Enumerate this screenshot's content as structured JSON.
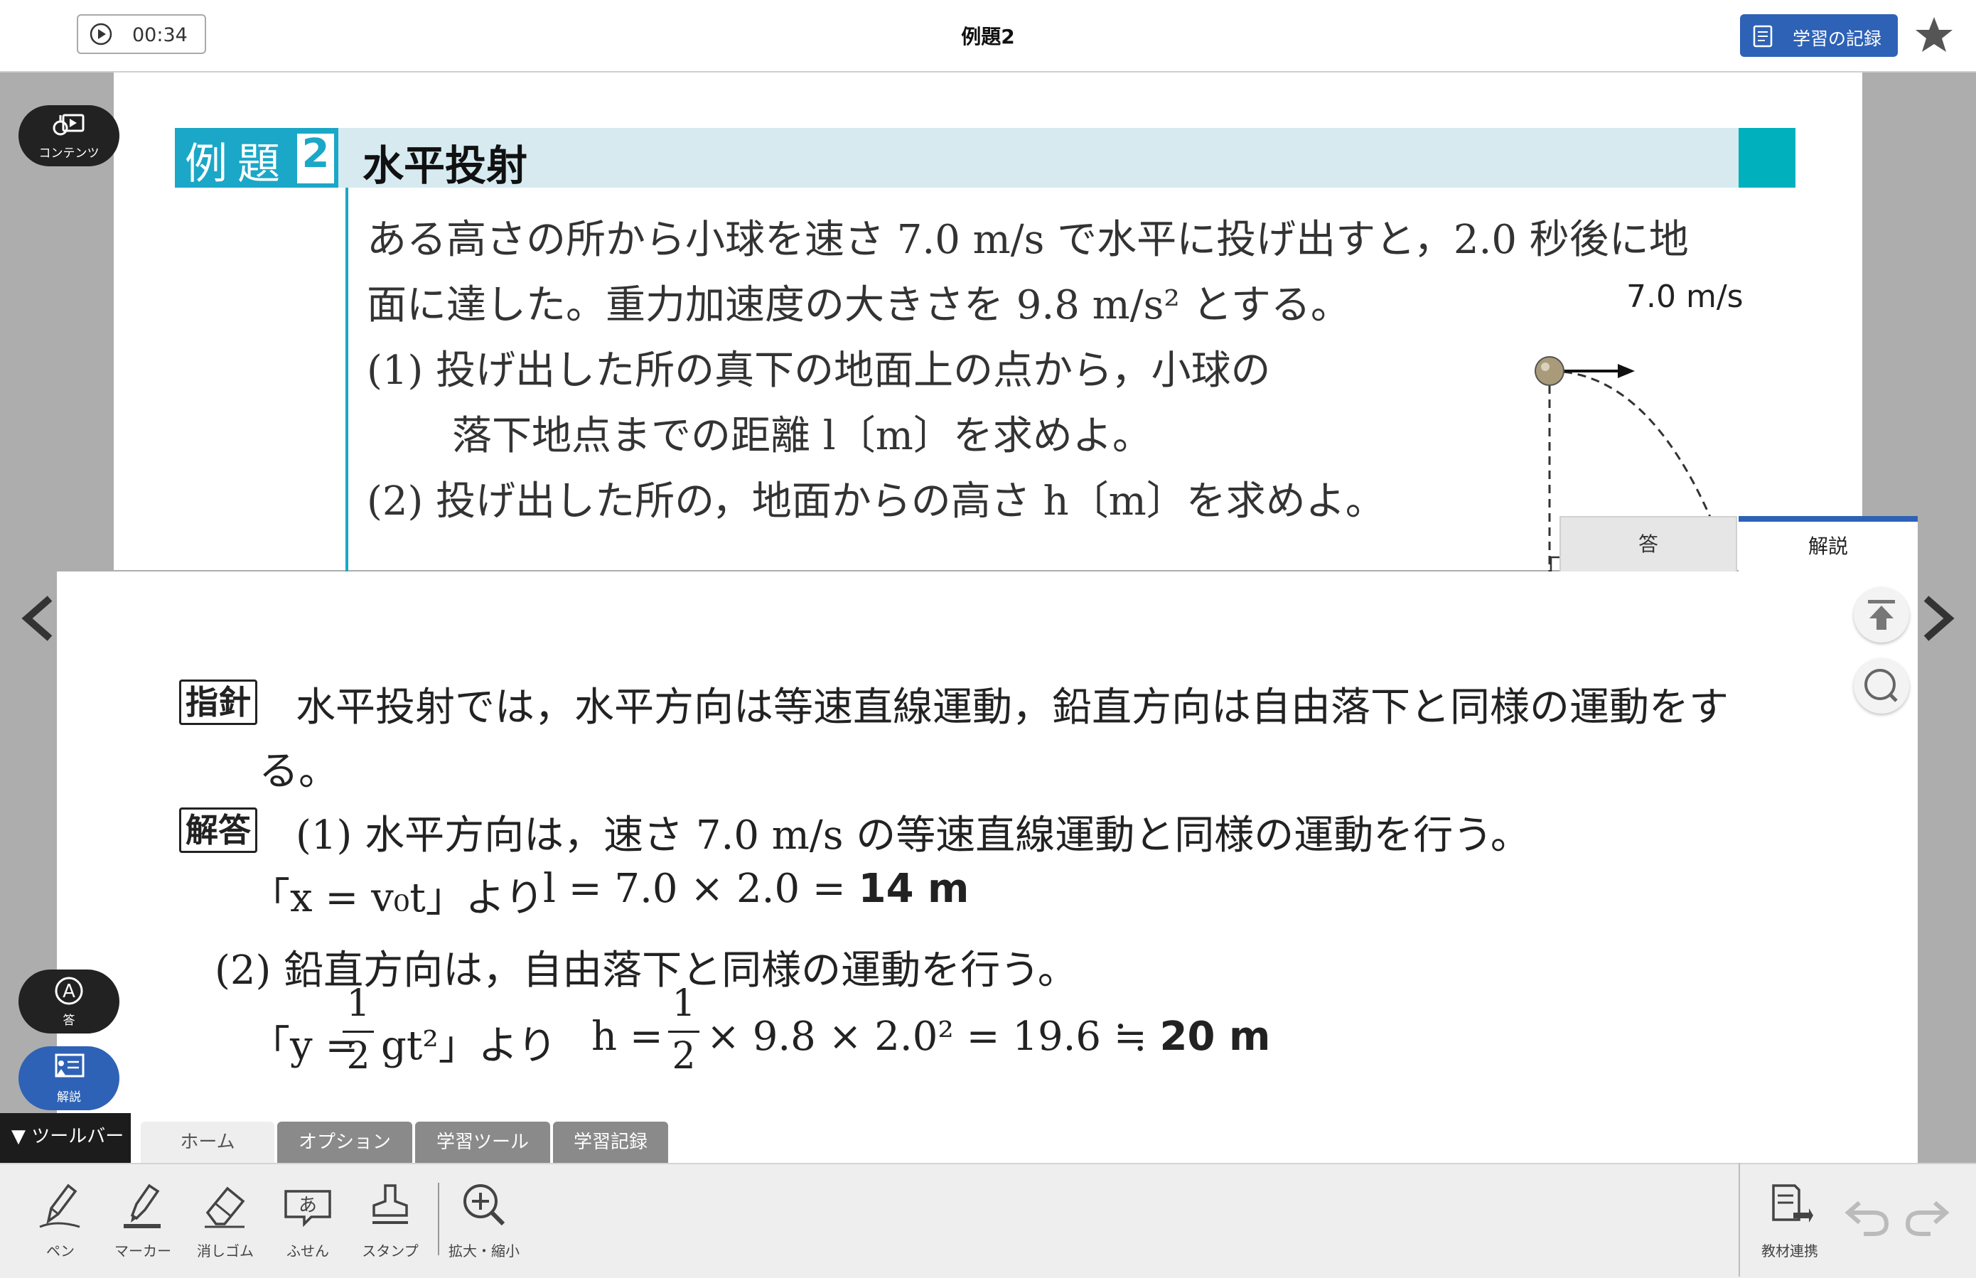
{
  "header": {
    "timer": "00:34",
    "title": "例題2",
    "record_button": "学習の記録"
  },
  "problem": {
    "label": "例題",
    "number": "2",
    "title": "水平投射",
    "lines": [
      "ある高さの所から小球を速さ 7.0 m/s で水平に投げ出すと，2.0 秒後に地",
      "面に達した。重力加速度の大きさを 9.8 m/s² とする。",
      "(1)  投げ出した所の真下の地面上の点から，小球の",
      "落下地点までの距離 l〔m〕を求めよ。",
      "(2)  投げ出した所の，地面からの高さ h〔m〕を求めよ。"
    ],
    "velocity_label": "7.0 m/s"
  },
  "answer_tabs": {
    "answer": "答",
    "explanation": "解説"
  },
  "explanation": {
    "hint_tag": "指針",
    "hint_line1": "水平投射では，水平方向は等速直線運動，鉛直方向は自由落下と同様の運動をす",
    "hint_line2": "る。",
    "answer_tag": "解答",
    "part1_head": "(1)   水平方向は，速さ 7.0 m/s の等速直線運動と同様の運動を行う。",
    "part1_eq_left": "「x = v₀t」より",
    "part1_eq_right": "l = 7.0 × 2.0 = ",
    "part1_result": "14 m",
    "part2_head": "(2)   鉛直方向は，自由落下と同様の運動を行う。",
    "part2_eq_a": "「y =",
    "part2_eq_b": "gt²」より",
    "part2_eq_c": "h =",
    "part2_eq_d": "× 9.8 × 2.0² = 19.6 ≒ ",
    "part2_result": "20 m",
    "frac_num": "1",
    "frac_den": "2"
  },
  "side_buttons": {
    "contents": "コンテンツ",
    "answer": "答",
    "explanation": "解説"
  },
  "toolbar": {
    "toggle": "▼ ツールバー",
    "tabs": [
      "ホーム",
      "オプション",
      "学習ツール",
      "学習記録"
    ],
    "tools": [
      "ペン",
      "マーカー",
      "消しゴム",
      "ふせん",
      "スタンプ",
      "拡大・縮小"
    ],
    "link": "教材連携"
  },
  "colors": {
    "accent_blue": "#2e62b6",
    "teal": "#1ba7c7"
  }
}
